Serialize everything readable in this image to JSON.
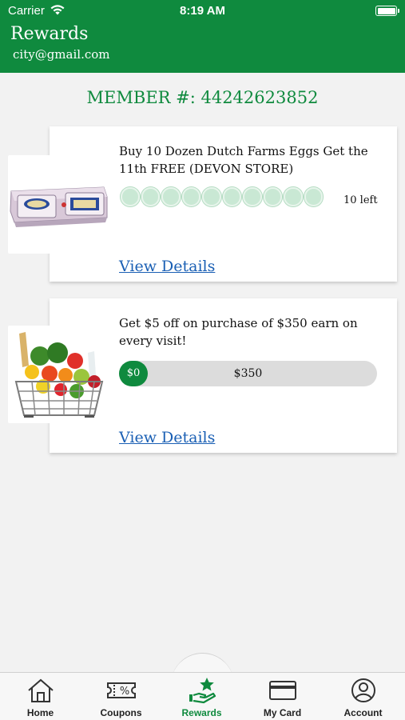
{
  "status_bar": {
    "carrier": "Carrier",
    "time": "8:19 AM"
  },
  "header": {
    "title": "Rewards",
    "email": "city@gmail.com"
  },
  "member": {
    "label": "MEMBER #: 44242623852"
  },
  "rewards": [
    {
      "title": "Buy 10 Dozen Dutch Farms Eggs Get the 11th FREE (DEVON STORE)",
      "punches_total": 10,
      "punches_filled": 0,
      "remaining": "10 left",
      "link": "View Details",
      "image": "egg-carton-image"
    },
    {
      "title": "Get $5 off on purchase of $350 earn on every visit!",
      "progress_start": "$0",
      "progress_goal": "$350",
      "progress_fraction": 0,
      "link": "View Details",
      "image": "grocery-basket-image"
    }
  ],
  "tabs": [
    {
      "label": "Home",
      "icon": "home-icon",
      "active": false
    },
    {
      "label": "Coupons",
      "icon": "coupon-icon",
      "active": false
    },
    {
      "label": "Rewards",
      "icon": "rewards-icon",
      "active": true
    },
    {
      "label": "My Card",
      "icon": "card-icon",
      "active": false
    },
    {
      "label": "Account",
      "icon": "account-icon",
      "active": false
    }
  ],
  "colors": {
    "brand_green": "#0f8a3e",
    "link_blue": "#1a5fb4",
    "punch_empty": "#c9e8d4"
  }
}
